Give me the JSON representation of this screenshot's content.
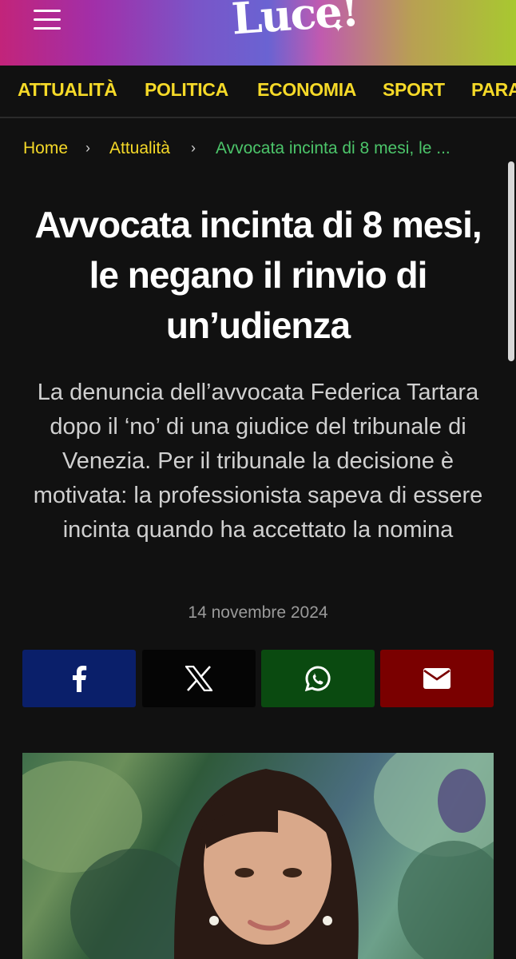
{
  "header": {
    "logo_text": "Luce!",
    "colors": {
      "nav_text": "#f5d928",
      "breadcrumb_current": "#4cc56a",
      "background": "#111111"
    }
  },
  "nav": {
    "items": [
      {
        "label": "ATTUALITÀ"
      },
      {
        "label": "POLITICA"
      },
      {
        "label": "ECONOMIA"
      },
      {
        "label": "SPORT"
      },
      {
        "label": "PARA"
      }
    ]
  },
  "breadcrumb": {
    "home": "Home",
    "section": "Attualità",
    "current": "Avvocata incinta di 8 mesi, le ..."
  },
  "article": {
    "title": "Avvocata incinta di 8 mesi, le negano il rinvio di un’udienza",
    "subtitle": "La denuncia dell’avvocata Federica Tartara dopo il ‘no’ di una giudice del tribunale di Venezia. Per il tribunale la decisione è motivata: la professionista sapeva di essere incinta quando ha accettato la nomina",
    "date": "14 novembre 2024"
  },
  "share": {
    "buttons": [
      {
        "icon": "facebook-icon",
        "color": "#0a1f6a"
      },
      {
        "icon": "x-icon",
        "color": "#050505"
      },
      {
        "icon": "whatsapp-icon",
        "color": "#0a4a10"
      },
      {
        "icon": "email-icon",
        "color": "#7a0000"
      }
    ]
  }
}
